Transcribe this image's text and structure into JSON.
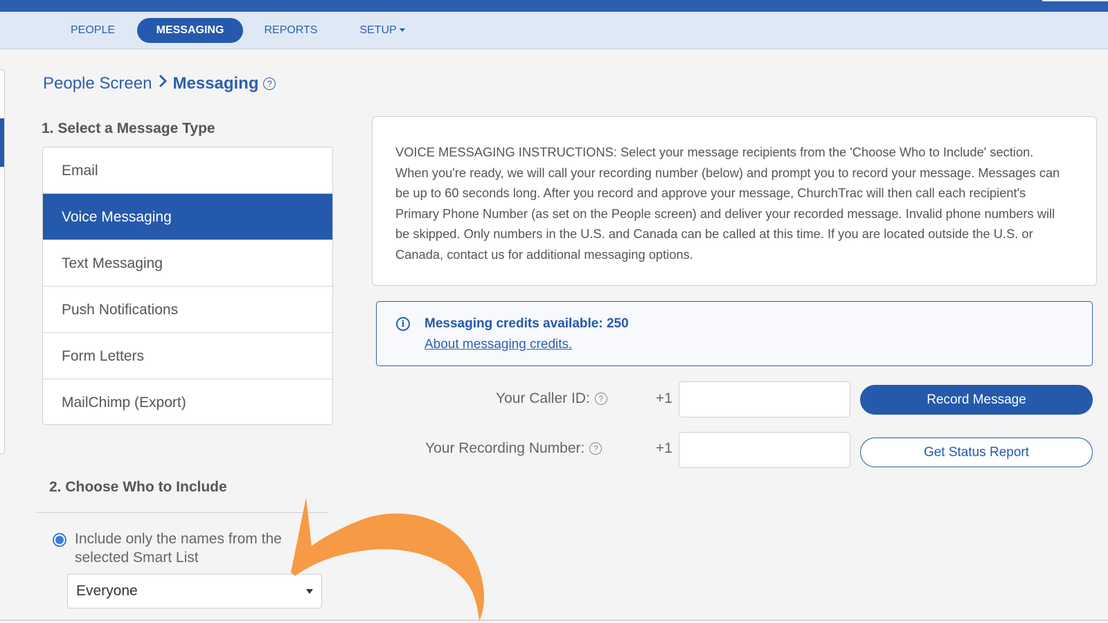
{
  "nav": {
    "items": [
      {
        "label": "PEOPLE"
      },
      {
        "label": "MESSAGING",
        "active": true
      },
      {
        "label": "REPORTS"
      },
      {
        "label": "SETUP"
      }
    ]
  },
  "breadcrumb": {
    "parent": "People Screen",
    "separator": ">",
    "current": "Messaging",
    "help_icon": "?"
  },
  "section1": {
    "title": "1. Select a Message Type",
    "items": [
      "Email",
      "Voice Messaging",
      "Text Messaging",
      "Push Notifications",
      "Form Letters",
      "MailChimp (Export)"
    ],
    "selected": "Voice Messaging"
  },
  "instructions": {
    "text": "VOICE MESSAGING INSTRUCTIONS: Select your message recipients from the 'Choose Who to Include' section. When you're ready, we will call your recording number (below) and prompt you to record your message. Messages can be up to 60 seconds long. After you record and approve your message, ChurchTrac will then call each recipient's Primary Phone Number (as set on the People screen) and deliver your recorded message. Invalid phone numbers will be skipped. Only numbers in the U.S. and Canada can be called at this time. If you are located outside the U.S. or Canada, contact us for additional messaging options."
  },
  "credits": {
    "icon": "info-icon",
    "text": "Messaging credits available: 250",
    "link": "About messaging credits."
  },
  "caller_id": {
    "label": "Your Caller ID:",
    "prefix": "+1",
    "value": ""
  },
  "recording_number": {
    "label": "Your Recording Number:",
    "prefix": "+1",
    "value": ""
  },
  "buttons": {
    "record": "Record Message",
    "status": "Get Status Report"
  },
  "section2": {
    "title": "2. Choose Who to Include",
    "radio_label": "Include only the names from the selected Smart List",
    "smart_list_selected": "Everyone"
  },
  "colors": {
    "primary": "#2559ab",
    "nav_bg": "#dfe9f5",
    "page_bg": "#f4f4f4",
    "annotation_arrow": "#f79a45"
  }
}
